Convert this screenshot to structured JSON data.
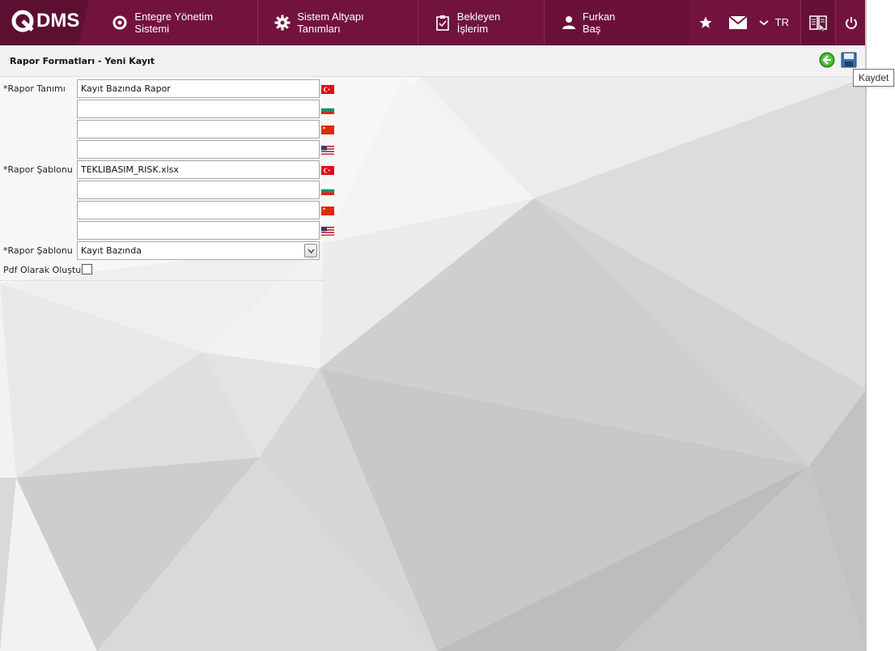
{
  "app": {
    "logo_text": "DMS"
  },
  "nav": {
    "items": [
      {
        "label": "Entegre Yönetim Sistemi",
        "icon": "qdms-circle-icon"
      },
      {
        "label": "Sistem Altyapı Tanımları",
        "icon": "gear-icon"
      },
      {
        "label": "Bekleyen İşlerim",
        "icon": "clipboard-icon"
      }
    ],
    "user": {
      "label": "Furkan Baş",
      "icon": "user-icon"
    },
    "language": "TR",
    "right_icons": [
      "star-icon",
      "mail-icon",
      "chevron-down-icon",
      "book-icon",
      "power-icon"
    ]
  },
  "page": {
    "title": "Rapor Formatları - Yeni Kayıt",
    "tooltip": "Kaydet"
  },
  "form": {
    "rapor_tanimi_label": "*Rapor Tanımı",
    "rapor_tanimi_values": [
      "Kayıt Bazında Rapor",
      "",
      "",
      ""
    ],
    "rapor_sablonu_label": "*Rapor Şablonu",
    "rapor_sablonu_values": [
      "TEKLIBASIM_RISK.xlsx",
      "",
      "",
      ""
    ],
    "rapor_sablonu_tipi_label": "*Rapor Şablonu",
    "rapor_sablonu_tipi_value": "Kayıt Bazında",
    "pdf_label": "Pdf Olarak Oluştur",
    "pdf_checked": false
  },
  "colors": {
    "brand": "#72133f",
    "brand_dark": "#5d0f32"
  }
}
